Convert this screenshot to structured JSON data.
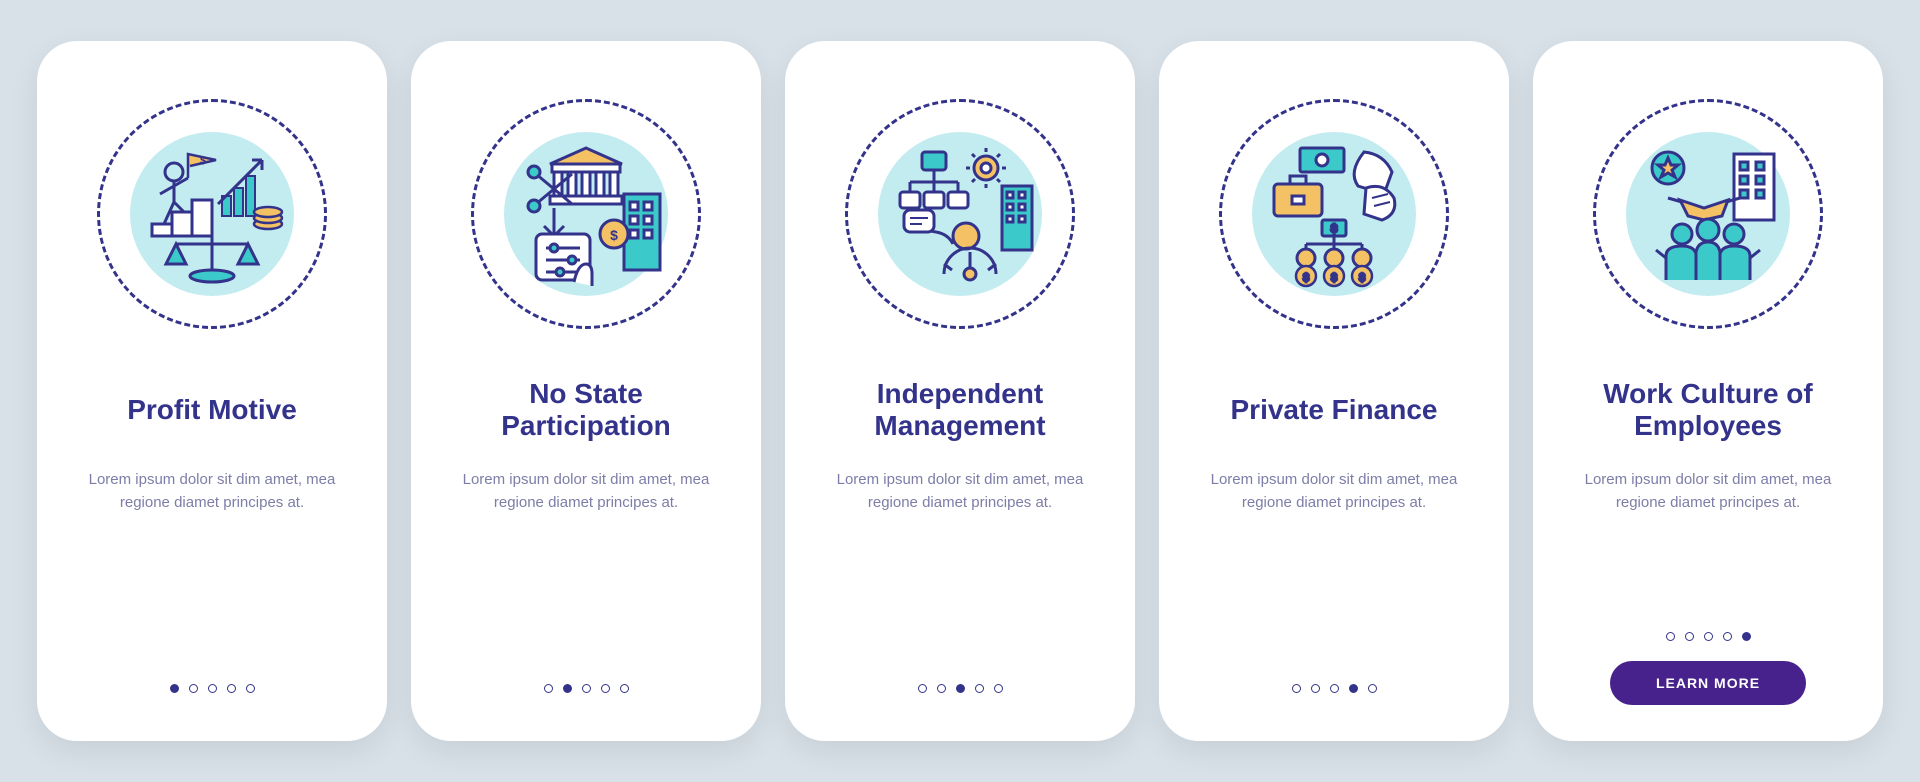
{
  "cards": [
    {
      "title": "Profit Motive",
      "desc": "Lorem ipsum dolor sit dim amet, mea regione diamet principes at."
    },
    {
      "title": "No State Participation",
      "desc": "Lorem ipsum dolor sit dim amet, mea regione diamet principes at."
    },
    {
      "title": "Independent Management",
      "desc": "Lorem ipsum dolor sit dim amet, mea regione diamet principes at."
    },
    {
      "title": "Private Finance",
      "desc": "Lorem ipsum dolor sit dim amet, mea regione diamet principes at."
    },
    {
      "title": "Work Culture of Employees",
      "desc": "Lorem ipsum dolor sit dim amet, mea regione diamet principes at."
    }
  ],
  "cta_label": "LEARN MORE",
  "colors": {
    "primary": "#33338b",
    "accent_teal": "#3bc9c9",
    "accent_yellow": "#f5c165",
    "bg": "#d8e1e8",
    "cta": "#48228c"
  }
}
